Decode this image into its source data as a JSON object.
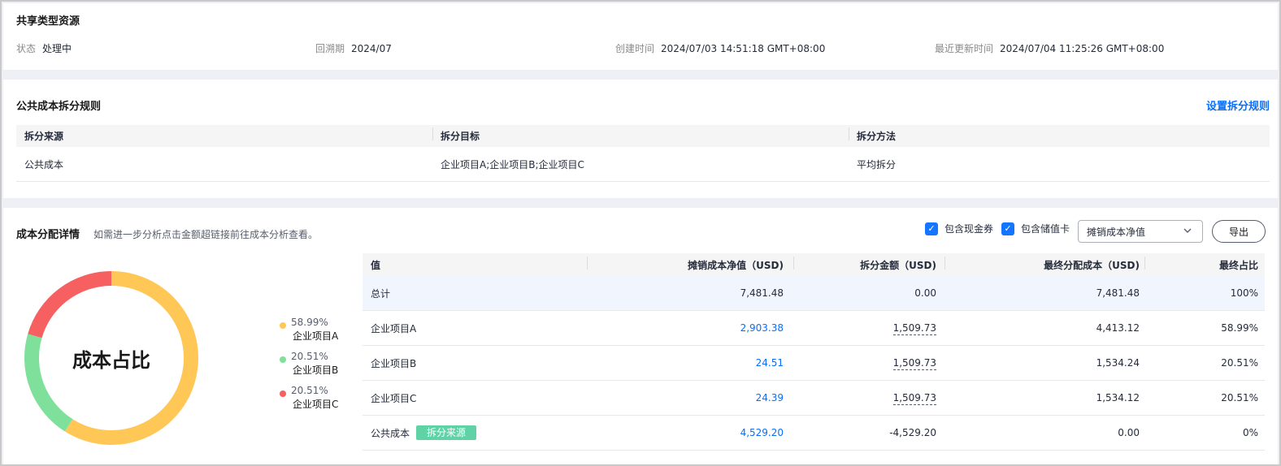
{
  "info": {
    "title": "共享类型资源",
    "status_label": "状态",
    "status_value": "处理中",
    "period_label": "回溯期",
    "period_value": "2024/07",
    "created_label": "创建时间",
    "created_value": "2024/07/03 14:51:18 GMT+08:00",
    "updated_label": "最近更新时间",
    "updated_value": "2024/07/04 11:25:26 GMT+08:00"
  },
  "rules": {
    "title": "公共成本拆分规则",
    "set_link": "设置拆分规则",
    "headers": [
      "拆分来源",
      "拆分目标",
      "拆分方法"
    ],
    "row": [
      "公共成本",
      "企业项目A;企业项目B;企业项目C",
      "平均拆分"
    ]
  },
  "detail": {
    "title": "成本分配详情",
    "subtitle": "如需进一步分析点击金额超链接前往成本分析查看。",
    "checkbox_coupon": "包含现金券",
    "checkbox_card": "包含储值卡",
    "select_value": "摊销成本净值",
    "export_label": "导出",
    "donut_center": "成本占比",
    "legend": [
      {
        "pct": "58.99%",
        "name": "企业项目A",
        "color": "#ffc756"
      },
      {
        "pct": "20.51%",
        "name": "企业项目B",
        "color": "#7fe09b"
      },
      {
        "pct": "20.51%",
        "name": "企业项目C",
        "color": "#f66060"
      }
    ],
    "donut_shares": [
      58.99,
      20.51,
      20.51
    ],
    "table": {
      "headers": [
        "值",
        "摊销成本净值（USD)",
        "拆分金额（USD)",
        "最终分配成本（USD)",
        "最终占比"
      ],
      "rows": [
        {
          "name": "总计",
          "net": "7,481.48",
          "split": "0.00",
          "final": "7,481.48",
          "ratio": "100%"
        },
        {
          "name": "企业项目A",
          "net": "2,903.38",
          "split": "1,509.73",
          "final": "4,413.12",
          "ratio": "58.99%"
        },
        {
          "name": "企业项目B",
          "net": "24.51",
          "split": "1,509.73",
          "final": "1,534.24",
          "ratio": "20.51%"
        },
        {
          "name": "企业项目C",
          "net": "24.39",
          "split": "1,509.73",
          "final": "1,534.12",
          "ratio": "20.51%"
        },
        {
          "name": "公共成本",
          "tag": "拆分来源",
          "net": "4,529.20",
          "split": "-4,529.20",
          "final": "0.00",
          "ratio": "0%"
        }
      ]
    }
  }
}
